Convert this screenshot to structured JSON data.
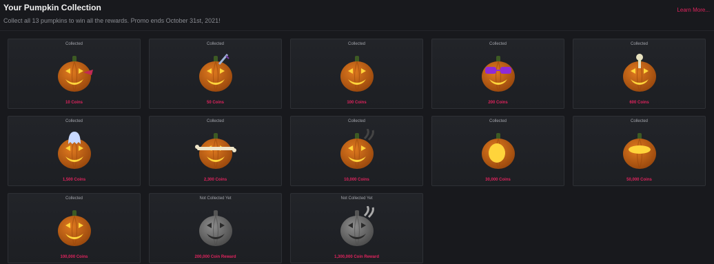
{
  "header": {
    "title": "Your Pumpkin Collection",
    "subtitle": "Collect all 13 pumpkins to win all the rewards. Promo ends October 31st, 2021!",
    "learn_more": "Learn More..."
  },
  "colors": {
    "background": "#18191d",
    "card": "#212328",
    "accent": "#e0245e",
    "pumpkin": "#e07a1f"
  },
  "pumpkins": [
    {
      "status": "Collected",
      "reward": "10 Coins",
      "icon": "pumpkin-tongue-icon",
      "collected": true
    },
    {
      "status": "Collected",
      "reward": "50 Coins",
      "icon": "pumpkin-knife-icon",
      "collected": true
    },
    {
      "status": "Collected",
      "reward": "100 Coins",
      "icon": "pumpkin-tall-icon",
      "collected": true
    },
    {
      "status": "Collected",
      "reward": "200 Coins",
      "icon": "pumpkin-sunglasses-icon",
      "collected": true
    },
    {
      "status": "Collected",
      "reward": "600 Coins",
      "icon": "pumpkin-skeleton-icon",
      "collected": true
    },
    {
      "status": "Collected",
      "reward": "1,500 Coins",
      "icon": "pumpkin-ghost-icon",
      "collected": true
    },
    {
      "status": "Collected",
      "reward": "2,300 Coins",
      "icon": "pumpkin-bone-icon",
      "collected": true
    },
    {
      "status": "Collected",
      "reward": "10,000 Coins",
      "icon": "pumpkin-smoke-icon",
      "collected": true
    },
    {
      "status": "Collected",
      "reward": "30,000 Coins",
      "icon": "pumpkin-glowing-icon",
      "collected": true
    },
    {
      "status": "Collected",
      "reward": "50,000 Coins",
      "icon": "pumpkin-open-top-icon",
      "collected": true
    },
    {
      "status": "Collected",
      "reward": "100,000 Coins",
      "icon": "pumpkin-classic-icon",
      "collected": true
    },
    {
      "status": "Not Collected Yet",
      "reward": "200,000 Coin Reward",
      "icon": "pumpkin-locked-icon",
      "collected": false
    },
    {
      "status": "Not Collected Yet",
      "reward": "1,300,000 Coin Reward",
      "icon": "pumpkin-smoke-locked-icon",
      "collected": false
    }
  ]
}
